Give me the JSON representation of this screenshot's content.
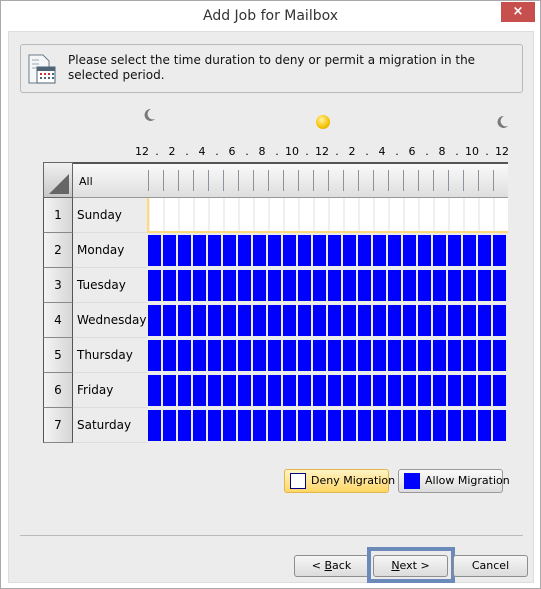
{
  "window": {
    "title": "Add Job for Mailbox",
    "close_label": "×"
  },
  "info": {
    "icon": "calendar-document-icon",
    "text": "Please select the time duration to deny or permit a migration in the selected period."
  },
  "timeline": {
    "icons": [
      "moon-icon",
      "sun-icon",
      "moon-icon"
    ],
    "hour_labels": [
      "12",
      ".",
      "2",
      ".",
      "4",
      ".",
      "6",
      ".",
      "8",
      ".",
      "10",
      ".",
      "12",
      ".",
      "2",
      ".",
      "4",
      ".",
      "6",
      ".",
      "8",
      ".",
      "10",
      ".",
      "12"
    ]
  },
  "grid": {
    "header_label": "All",
    "hours": 24,
    "rows": [
      {
        "num": "1",
        "day": "Sunday",
        "state": "deny",
        "selected": true
      },
      {
        "num": "2",
        "day": "Monday",
        "state": "allow",
        "selected": false
      },
      {
        "num": "3",
        "day": "Tuesday",
        "state": "allow",
        "selected": false
      },
      {
        "num": "4",
        "day": "Wednesday",
        "state": "allow",
        "selected": false
      },
      {
        "num": "5",
        "day": "Thursday",
        "state": "allow",
        "selected": false
      },
      {
        "num": "6",
        "day": "Friday",
        "state": "allow",
        "selected": false
      },
      {
        "num": "7",
        "day": "Saturday",
        "state": "allow",
        "selected": false
      }
    ]
  },
  "legend": {
    "deny_label": "Deny Migration",
    "allow_label": "Allow Migration",
    "deny_color": "#ffffff",
    "allow_color": "#0000ff",
    "active": "deny"
  },
  "buttons": {
    "back_prefix": "< ",
    "back_mnemonic": "B",
    "back_rest": "ack",
    "next_mnemonic": "N",
    "next_rest": "ext >",
    "cancel": "Cancel"
  }
}
